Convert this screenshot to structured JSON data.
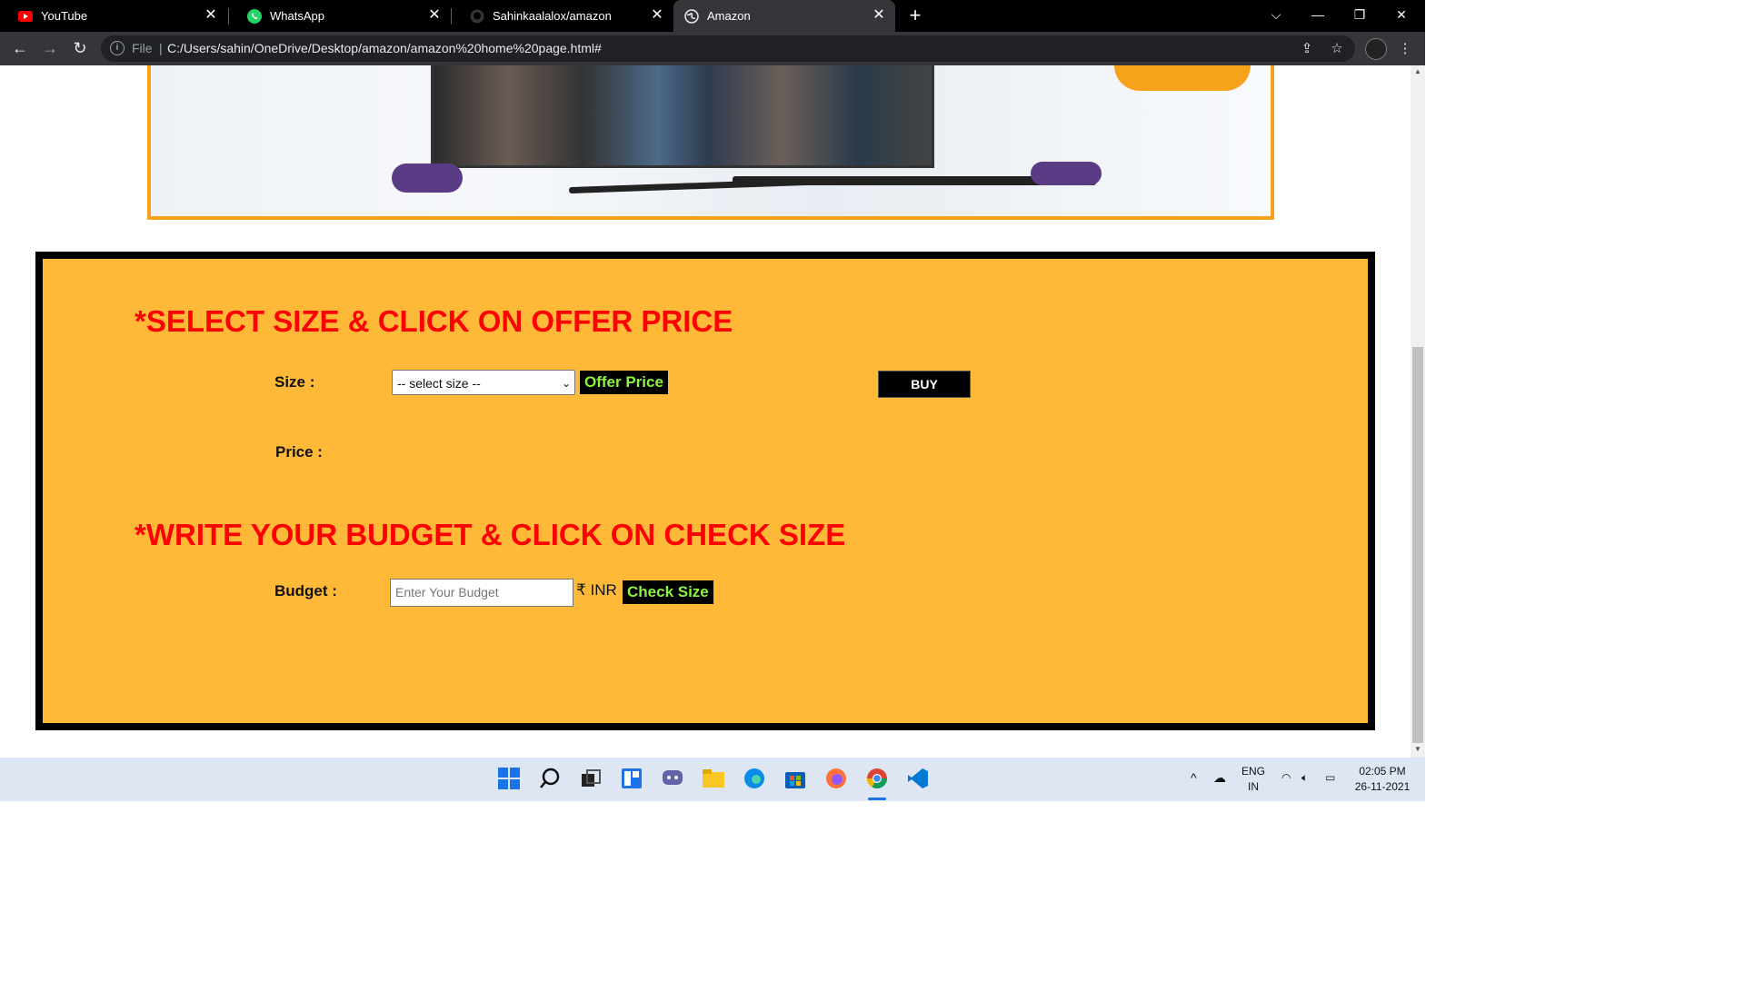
{
  "tabs": [
    {
      "label": "YouTube",
      "icon": "youtube-icon"
    },
    {
      "label": "WhatsApp",
      "icon": "whatsapp-icon"
    },
    {
      "label": "Sahinkaalalox/amazon",
      "icon": "github-icon"
    },
    {
      "label": "Amazon",
      "icon": "globe-icon",
      "active": true
    }
  ],
  "address": {
    "file_label": "File",
    "url": "C:/Users/sahin/OneDrive/Desktop/amazon/amazon%20home%20page.html#"
  },
  "page": {
    "heading1": "*SELECT SIZE & CLICK ON OFFER PRICE",
    "size_label": "Size :",
    "size_select_value": "-- select size --",
    "offer_price_label": "Offer Price",
    "buy_label": "BUY",
    "price_label": "Price :",
    "heading2": "*WRITE YOUR BUDGET & CLICK ON CHECK SIZE",
    "budget_label": "Budget :",
    "budget_placeholder": "Enter Your Budget",
    "currency": "₹ INR",
    "check_size_label": "Check Size"
  },
  "taskbar": {
    "lang": "ENG",
    "region": "IN",
    "time": "02:05 PM",
    "date": "26-11-2021"
  },
  "colors": {
    "form_bg": "#ffb938",
    "heading": "#ff0000",
    "green_text": "#8cf43d",
    "banner_border": "#f7a21b"
  }
}
